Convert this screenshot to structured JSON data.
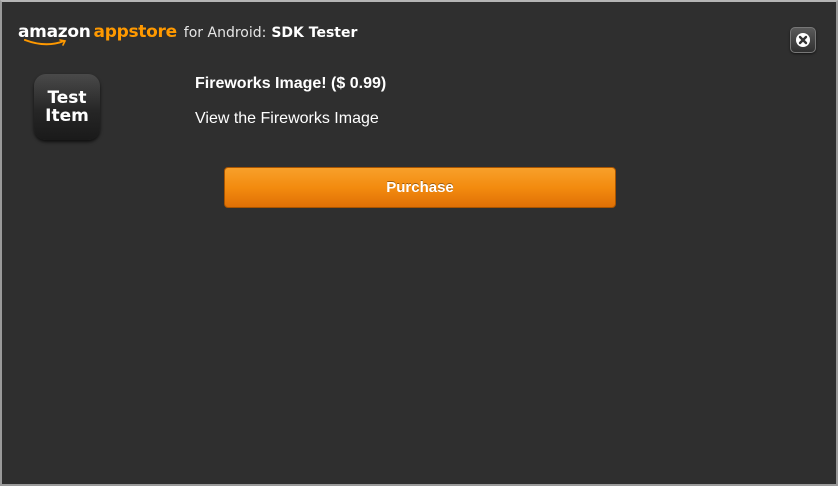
{
  "header": {
    "logo_amazon": "amazon",
    "logo_appstore": "appstore",
    "logo_for": "for Android:",
    "logo_tester": "SDK Tester",
    "close_icon": "close-x-icon"
  },
  "item": {
    "icon_line1": "Test",
    "icon_line2": "Item",
    "title": "Fireworks Image! ($ 0.99)",
    "description": "View the Fireworks Image"
  },
  "actions": {
    "purchase_label": "Purchase"
  },
  "colors": {
    "background": "#2f2f2f",
    "brand_orange": "#ff9900",
    "button_orange": "#f38b0f"
  }
}
